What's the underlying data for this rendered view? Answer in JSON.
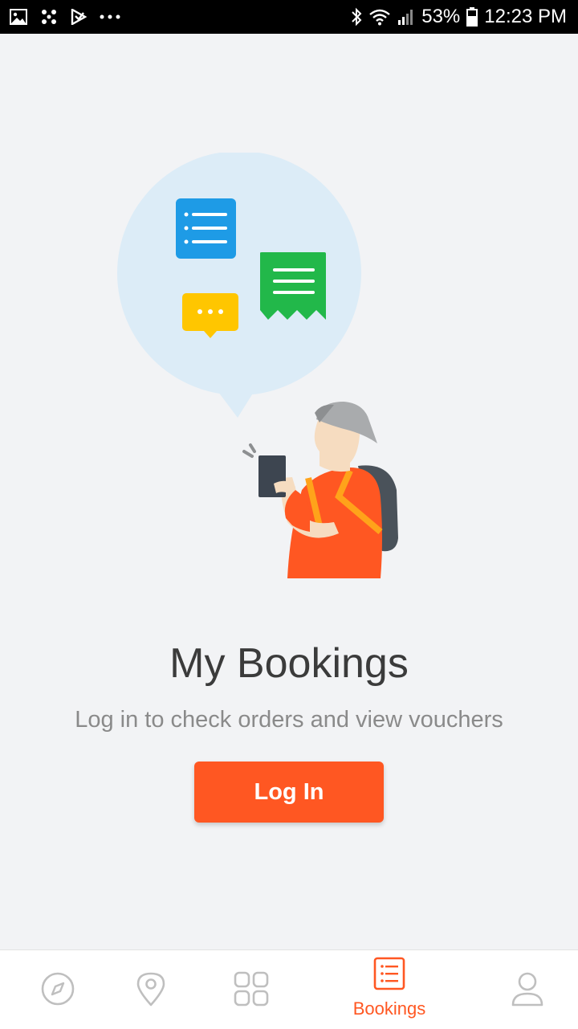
{
  "status_bar": {
    "left_icons": [
      "gallery-icon",
      "pinwheel-icon",
      "play-store-icon",
      "more-dots-icon"
    ],
    "right_icons": [
      "bluetooth-icon",
      "wifi-icon",
      "signal-icon",
      "battery-icon"
    ],
    "battery": "53%",
    "time": "12:23 PM"
  },
  "main": {
    "title": "My Bookings",
    "subtitle": "Log in to check orders and view vouchers",
    "login_label": "Log In"
  },
  "bottom_nav": {
    "items": [
      {
        "icon": "compass-icon",
        "label": ""
      },
      {
        "icon": "location-pin-icon",
        "label": ""
      },
      {
        "icon": "grid-icon",
        "label": ""
      },
      {
        "icon": "bookings-list-icon",
        "label": "Bookings",
        "active": true
      },
      {
        "icon": "profile-icon",
        "label": ""
      }
    ]
  },
  "colors": {
    "accent": "#ff5722",
    "background": "#f2f3f5",
    "bubble": "#dcecf7",
    "blue_card": "#1e9be6",
    "green_card": "#22b84a",
    "yellow_card": "#ffc600"
  }
}
